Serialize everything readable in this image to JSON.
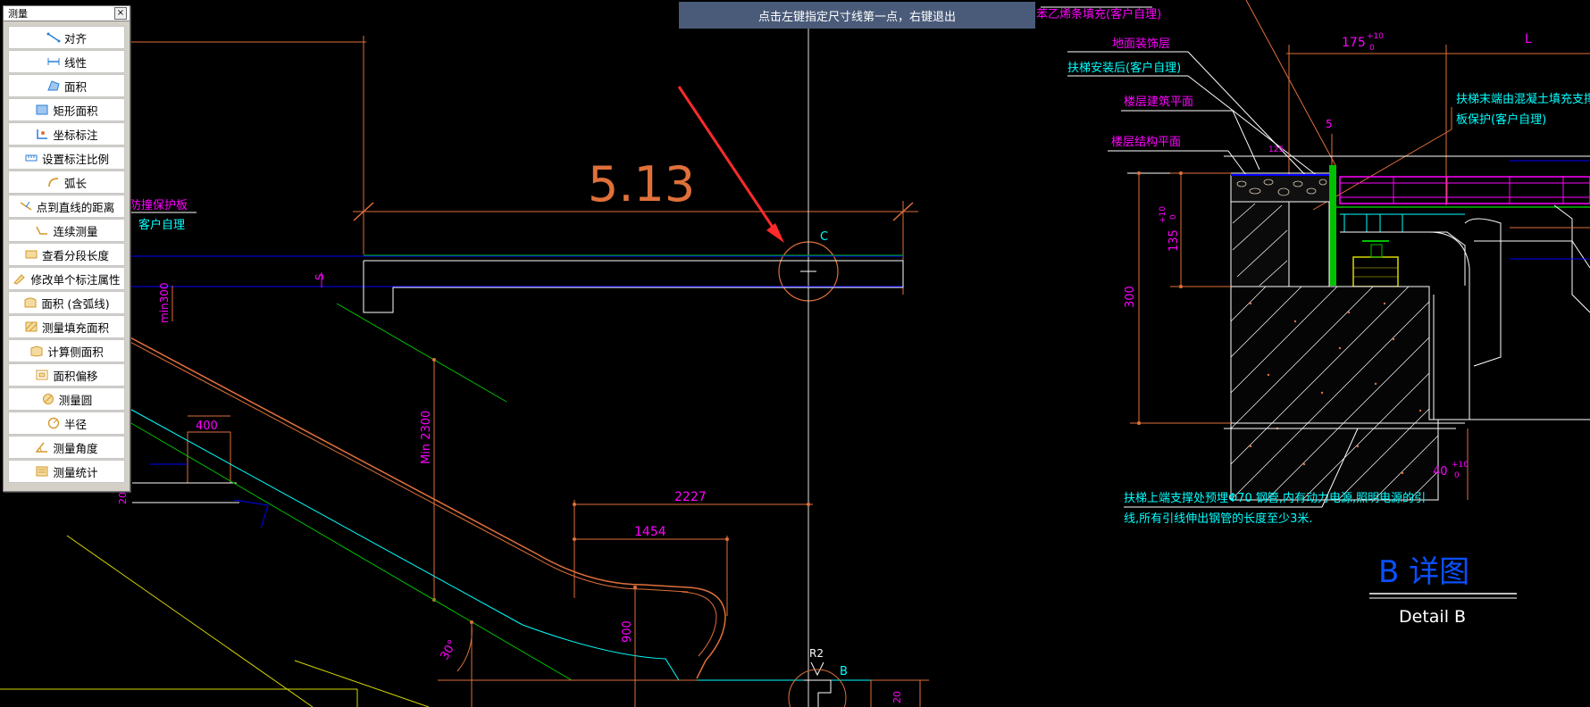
{
  "palette": {
    "title": "测量",
    "close_glyph": "×",
    "items": [
      {
        "label": "对齐",
        "icon": "aligned-dimension-icon"
      },
      {
        "label": "线性",
        "icon": "linear-dimension-icon"
      },
      {
        "label": "面积",
        "icon": "area-icon"
      },
      {
        "label": "矩形面积",
        "icon": "rectangle-area-icon"
      },
      {
        "label": "坐标标注",
        "icon": "coordinate-icon"
      },
      {
        "label": "设置标注比例",
        "icon": "scale-icon"
      },
      {
        "label": "弧长",
        "icon": "arc-length-icon"
      },
      {
        "label": "点到直线的距离",
        "icon": "point-line-distance-icon"
      },
      {
        "label": "连续测量",
        "icon": "continuous-measure-icon"
      },
      {
        "label": "查看分段长度",
        "icon": "segment-length-icon"
      },
      {
        "label": "修改单个标注属性",
        "icon": "edit-dimension-icon"
      },
      {
        "label": "面积 (含弧线)",
        "icon": "arc-area-icon"
      },
      {
        "label": "测量填充面积",
        "icon": "hatch-area-icon"
      },
      {
        "label": "计算侧面积",
        "icon": "side-area-icon"
      },
      {
        "label": "面积偏移",
        "icon": "area-offset-icon"
      },
      {
        "label": "测量圆",
        "icon": "circle-measure-icon"
      },
      {
        "label": "半径",
        "icon": "radius-icon"
      },
      {
        "label": "测量角度",
        "icon": "angle-icon"
      },
      {
        "label": "测量统计",
        "icon": "statistics-icon"
      }
    ]
  },
  "prompt": "点击左键指定尺寸线第一点，右键退出",
  "drawing": {
    "measured_value": "5.13",
    "left_labels": {
      "guard": "防撞保护板",
      "owner": "客户自理",
      "s": "S",
      "min300": "min300",
      "min2300": "Min 2300",
      "d400": "400",
      "d20": "20"
    },
    "dims": {
      "d2227": "2227",
      "d1454": "1454",
      "d900": "900",
      "angle30": "30°",
      "c": "C",
      "r2": "R2",
      "b": "B",
      "d20b": "20"
    },
    "detail": {
      "top_note": "苯乙烯条填充(客户自理)",
      "floor_finish": "地面装饰层",
      "after_install": "扶梯安装后(客户自理)",
      "arch_level": "楼层建筑平面",
      "struct_level": "楼层结构平面",
      "right_note_1": "扶梯末端由混凝土填充支撑,泡沫",
      "right_note_2": "板保护(客户自理)",
      "dim_175": "175",
      "tol_plus": "+10",
      "tol_zero": "0",
      "dim_L": "L",
      "dim_5": "5",
      "dim_125": "125",
      "dim_135": "135",
      "dim_300": "300",
      "dim_40": "40",
      "bottom_note_1": "扶梯上端支撑处预埋Φ70 钢管,内有动力电源,照明电源的引",
      "bottom_note_2": "线,所有引线伸出钢管的长度至少3米.",
      "title_b": "B  详图",
      "title_en": "Detail  B"
    }
  },
  "colors": {
    "cad_bg": "#000000",
    "dim_orange": "#e0703a",
    "magenta": "#ff00ff",
    "cyan": "#00ffff",
    "white": "#ffffff",
    "green": "#00c000",
    "yellow": "#d8d800",
    "prompt_bg": "#4a5b79"
  }
}
